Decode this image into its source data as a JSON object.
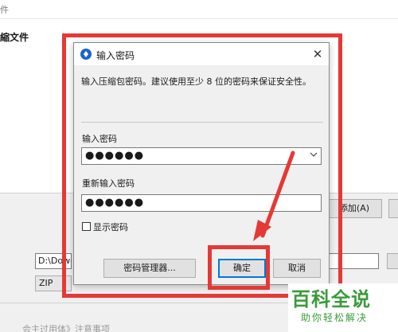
{
  "background": {
    "window_title_fragment": "件",
    "header_title": "縮文件",
    "add_button": "添加(A)",
    "path_value": "D:\\Dowol",
    "format_value": "ZIP",
    "footer_text": "会主过用体》注意事项"
  },
  "dialog": {
    "title": "输入密码",
    "description": "输入压缩包密码。建议使用至少 8 位的密码来保证安全性。",
    "password_label": "输入密码",
    "password_value": "●●●●●●",
    "confirm_label": "重新输入密码",
    "confirm_value": "●●●●●●",
    "show_password_label": "显示密码",
    "show_password_checked": false,
    "buttons": {
      "manager": "密码管理器...",
      "ok": "确定",
      "cancel": "取消"
    }
  },
  "icons": {
    "app": "app-logo-icon",
    "close": "close-icon",
    "dropdown": "chevron-down-icon"
  },
  "watermark": {
    "logo": "百科全说",
    "subtitle": "助你轻松解决"
  },
  "colors": {
    "highlight": "#e53935",
    "accent": "#0078d7",
    "watermark": "#3a9b3a"
  }
}
